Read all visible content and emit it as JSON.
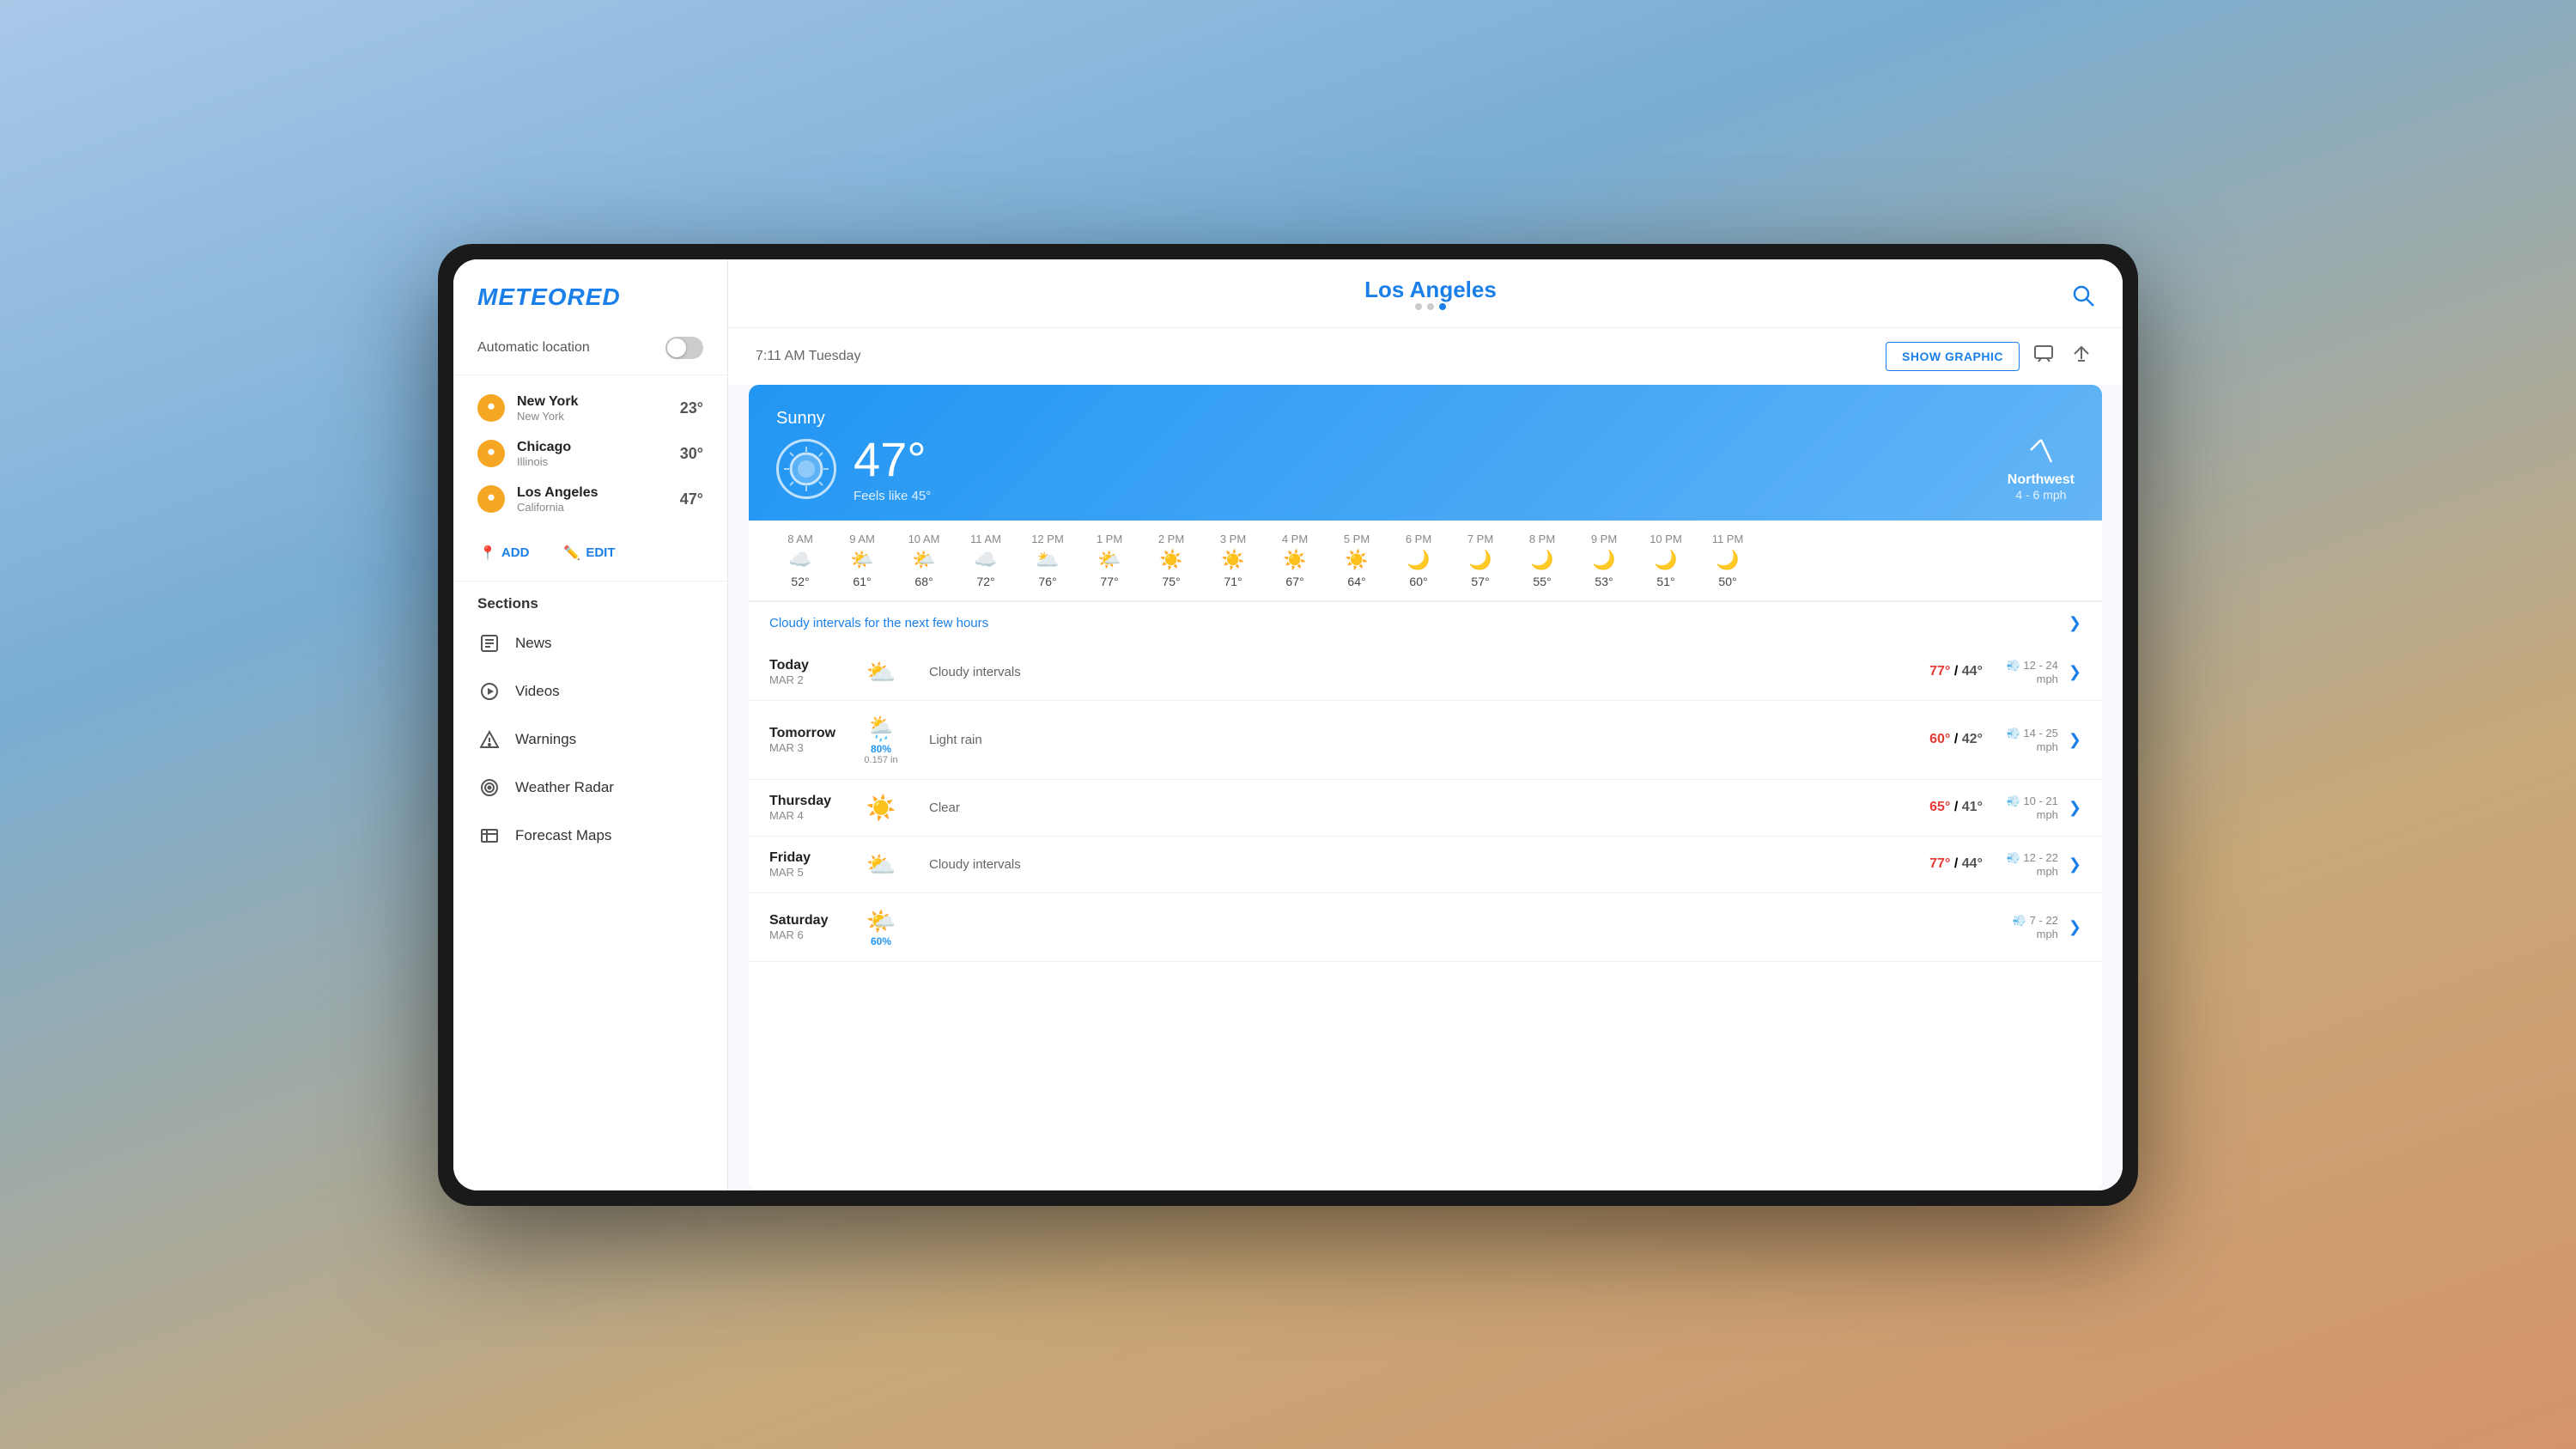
{
  "app": {
    "logo": "METEORED"
  },
  "sidebar": {
    "auto_location_label": "Automatic location",
    "toggle_state": "off",
    "locations": [
      {
        "name": "New York",
        "state": "New York",
        "temp": "23°"
      },
      {
        "name": "Chicago",
        "state": "Illinois",
        "temp": "30°"
      },
      {
        "name": "Los Angeles",
        "state": "California",
        "temp": "47°"
      }
    ],
    "add_label": "ADD",
    "edit_label": "EDIT",
    "sections_label": "Sections",
    "nav_items": [
      {
        "id": "news",
        "label": "News",
        "icon": "grid"
      },
      {
        "id": "videos",
        "label": "Videos",
        "icon": "play"
      },
      {
        "id": "warnings",
        "label": "Warnings",
        "icon": "triangle"
      },
      {
        "id": "radar",
        "label": "Weather Radar",
        "icon": "circle-dot"
      },
      {
        "id": "forecast-maps",
        "label": "Forecast Maps",
        "icon": "layers"
      }
    ]
  },
  "header": {
    "city": "Los Angeles",
    "dots": [
      false,
      false,
      true
    ],
    "time": "7:11 AM  Tuesday",
    "show_graphic_label": "SHOW GRAPHIC"
  },
  "weather": {
    "condition": "Sunny",
    "temp": "47°",
    "feels_like": "Feels like 45°",
    "wind_direction": "Northwest",
    "wind_speed": "4 - 6 mph",
    "hourly": [
      {
        "time": "8 AM",
        "icon": "☁️",
        "temp": "52°"
      },
      {
        "time": "9 AM",
        "icon": "🌤️",
        "temp": "61°"
      },
      {
        "time": "10 AM",
        "icon": "🌤️",
        "temp": "68°"
      },
      {
        "time": "11 AM",
        "icon": "☁️",
        "temp": "72°"
      },
      {
        "time": "12 PM",
        "icon": "🌥️",
        "temp": "76°"
      },
      {
        "time": "1 PM",
        "icon": "🌤️",
        "temp": "77°"
      },
      {
        "time": "2 PM",
        "icon": "☀️",
        "temp": "75°"
      },
      {
        "time": "3 PM",
        "icon": "☀️",
        "temp": "71°"
      },
      {
        "time": "4 PM",
        "icon": "☀️",
        "temp": "67°"
      },
      {
        "time": "5 PM",
        "icon": "☀️",
        "temp": "64°"
      },
      {
        "time": "6 PM",
        "icon": "🌙",
        "temp": "60°"
      },
      {
        "time": "7 PM",
        "icon": "🌙",
        "temp": "57°"
      },
      {
        "time": "8 PM",
        "icon": "🌙",
        "temp": "55°"
      },
      {
        "time": "9 PM",
        "icon": "🌙",
        "temp": "53°"
      },
      {
        "time": "10 PM",
        "icon": "🌙",
        "temp": "51°"
      },
      {
        "time": "11 PM",
        "icon": "🌙",
        "temp": "50°"
      }
    ],
    "alert": "Cloudy intervals for the next few hours",
    "forecast": [
      {
        "day": "Today",
        "date": "MAR 2",
        "icon": "⛅",
        "precip": "",
        "precip_in": "",
        "description": "Cloudy intervals",
        "high": "77°",
        "low": "44°",
        "wind": "12 - 24 mph"
      },
      {
        "day": "Tomorrow",
        "date": "MAR 3",
        "icon": "🌦️",
        "precip": "80%",
        "precip_in": "0.157 in",
        "description": "Light rain",
        "high": "60°",
        "low": "42°",
        "wind": "14 - 25 mph"
      },
      {
        "day": "Thursday",
        "date": "MAR 4",
        "icon": "☀️",
        "precip": "",
        "precip_in": "",
        "description": "Clear",
        "high": "65°",
        "low": "41°",
        "wind": "10 - 21 mph"
      },
      {
        "day": "Friday",
        "date": "MAR 5",
        "icon": "⛅",
        "precip": "",
        "precip_in": "",
        "description": "Cloudy intervals",
        "high": "77°",
        "low": "44°",
        "wind": "12 - 22 mph"
      },
      {
        "day": "Saturday",
        "date": "MAR 6",
        "icon": "🌤️",
        "precip": "60%",
        "precip_in": "",
        "description": "",
        "high": "",
        "low": "",
        "wind": "7 - 22 mph"
      }
    ]
  }
}
